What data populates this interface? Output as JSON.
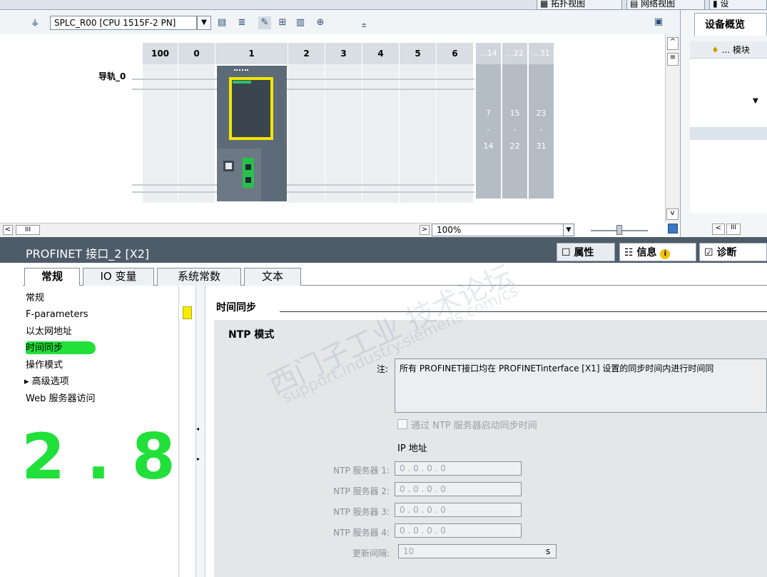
{
  "top_tabs": [
    {
      "label": "拓扑视图"
    },
    {
      "label": "网络视图"
    },
    {
      "label": "设"
    }
  ],
  "toolbar": {
    "device_select": "SPLC_R00 [CPU 1515F-2 PN]",
    "zoom": "100%"
  },
  "rack": {
    "slot_headers": [
      "100",
      "0",
      "1",
      "2",
      "3",
      "4",
      "5",
      "6",
      "...14",
      "...22",
      "...31"
    ],
    "rail_label": "导轨_0",
    "extension_groups": [
      {
        "top": "7",
        "bottom": "14"
      },
      {
        "top": "15",
        "bottom": "22"
      },
      {
        "top": "23",
        "bottom": "31"
      }
    ],
    "ext_dash": "-"
  },
  "overview": {
    "title": "设备概览",
    "col_module": "模块"
  },
  "properties": {
    "title": "PROFINET 接口_2 [X2]",
    "right_tabs": [
      {
        "label": "属性"
      },
      {
        "label": "信息"
      },
      {
        "label": "诊断"
      }
    ],
    "tabs": [
      {
        "label": "常规"
      },
      {
        "label": "IO 变量"
      },
      {
        "label": "系统常数"
      },
      {
        "label": "文本"
      }
    ],
    "nav": [
      {
        "label": "常规"
      },
      {
        "label": "F-parameters"
      },
      {
        "label": "以太网地址"
      },
      {
        "label": "时间同步"
      },
      {
        "label": "操作模式"
      },
      {
        "label": "▸ 高级选项"
      },
      {
        "label": "Web 服务器访问"
      }
    ],
    "section_title": "时间同步",
    "sub_title": "NTP 模式",
    "note_label": "注:",
    "note_text": "所有 PROFINET接口均在 PROFINETinterface [X1] 设置的同步时间内进行时间同",
    "checkbox_label": "通过 NTP 服务器启动同步时间",
    "ip_heading": "IP 地址",
    "ntp_servers": [
      {
        "label": "NTP 服务器 1:",
        "value": "0    . 0     . 0     . 0"
      },
      {
        "label": "NTP 服务器 2:",
        "value": "0    . 0     . 0     . 0"
      },
      {
        "label": "NTP 服务器 3:",
        "value": "0    . 0     . 0     . 0"
      },
      {
        "label": "NTP 服务器 4:",
        "value": "0    . 0     . 0     . 0"
      }
    ],
    "update_label": "更新间隔:",
    "update_value": "10",
    "update_unit": "s"
  },
  "annotation": {
    "handwritten": "2.8",
    "color": "#22e03a"
  },
  "watermark": {
    "line1": "西门子工业 技术论坛",
    "line2": "support.industry.siemens.com/cs"
  }
}
